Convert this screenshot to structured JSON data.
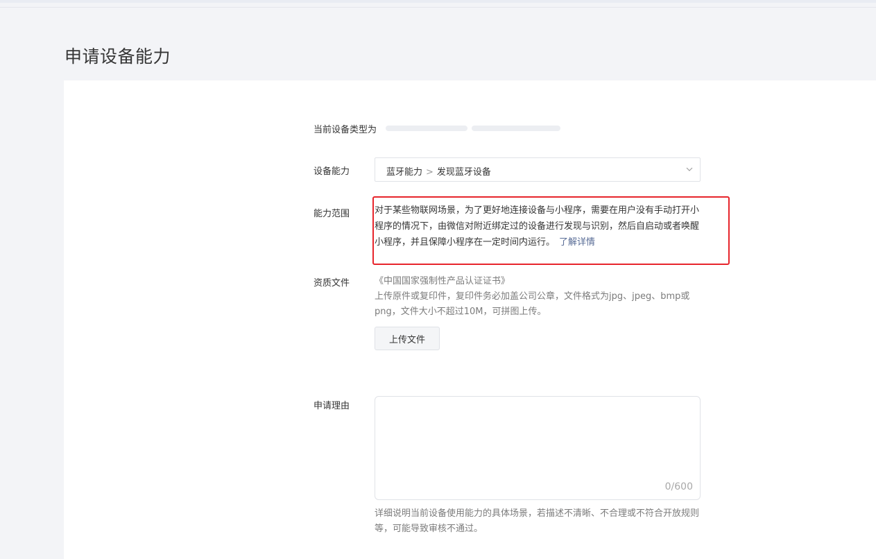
{
  "page": {
    "title": "申请设备能力"
  },
  "form": {
    "device_type_label": "当前设备类型为",
    "capability": {
      "label": "设备能力",
      "value_primary": "蓝牙能力",
      "value_secondary": "发现蓝牙设备",
      "separator": ">"
    },
    "scope": {
      "label": "能力范围",
      "description": "对于某些物联网场景，为了更好地连接设备与小程序，需要在用户没有手动打开小程序的情况下，由微信对附近绑定过的设备进行发现与识别，然后自启动或者唤醒小程序，并且保障小程序在一定时间内运行。",
      "link_text": "了解详情"
    },
    "qualification": {
      "label": "资质文件",
      "document_name": "《中国国家强制性产品认证证书》",
      "requirements": "上传原件或复印件，复印件务必加盖公司公章，文件格式为jpg、jpeg、bmp或png，文件大小不超过10M，可拼图上传。",
      "upload_button": "上传文件"
    },
    "reason": {
      "label": "申请理由",
      "value": "",
      "counter": "0/600",
      "hint": "详细说明当前设备使用能力的具体场景，若描述不清晰、不合理或不符合开放规则等，可能导致审核不通过。"
    }
  },
  "colors": {
    "link": "#576b95",
    "highlight_border": "#e7242b",
    "secondary_text": "#7b7b7b"
  },
  "icons": {
    "select_arrow": "chevron-down-icon"
  }
}
